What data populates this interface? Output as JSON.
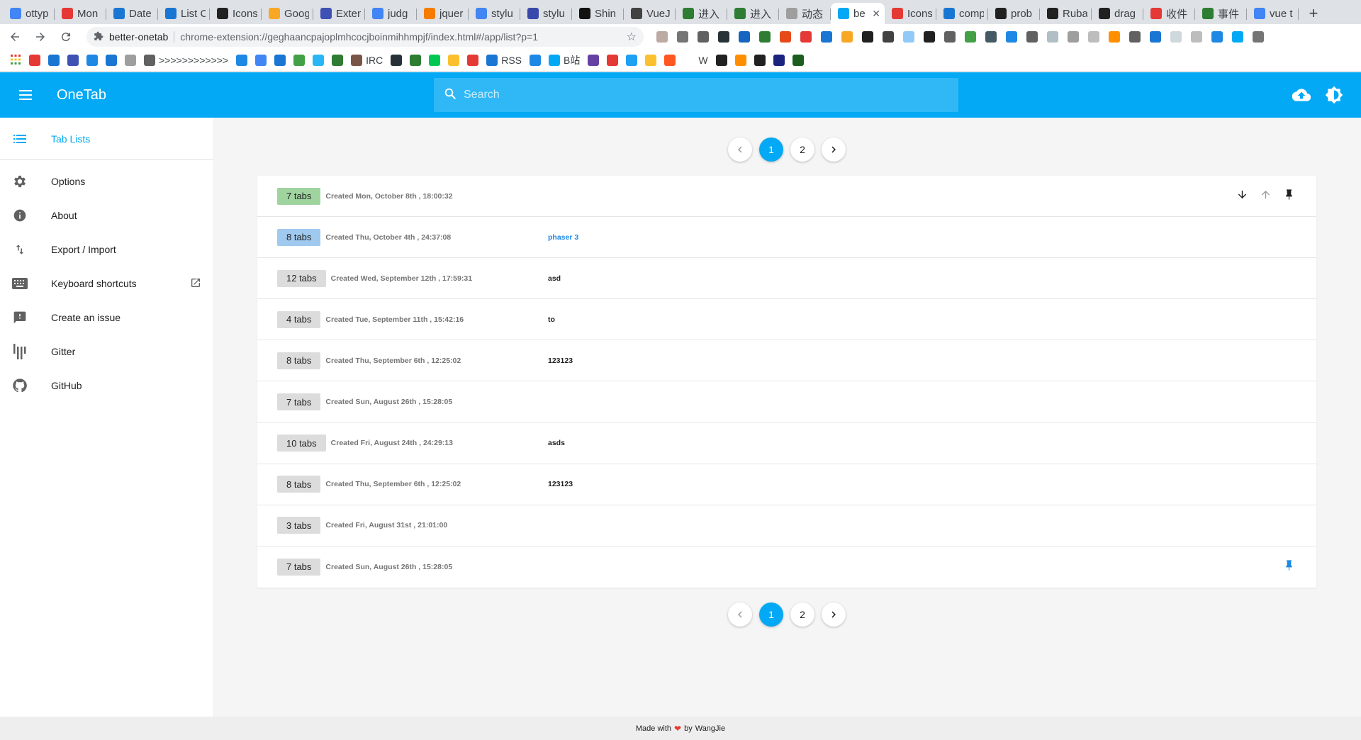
{
  "browser": {
    "tabs": [
      {
        "title": "ottyp",
        "color": "#4285f4"
      },
      {
        "title": "Mon",
        "color": "#e53935"
      },
      {
        "title": "Date",
        "color": "#1976d2"
      },
      {
        "title": "List C",
        "color": "#1976d2"
      },
      {
        "title": "Icons",
        "color": "#212121"
      },
      {
        "title": "Goog",
        "color": "#f9a825"
      },
      {
        "title": "Exten",
        "color": "#3f51b5"
      },
      {
        "title": "judg",
        "color": "#4285f4"
      },
      {
        "title": "jquer",
        "color": "#f57c00"
      },
      {
        "title": "stylu",
        "color": "#4285f4"
      },
      {
        "title": "stylu",
        "color": "#3949ab"
      },
      {
        "title": "Shin",
        "color": "#111111"
      },
      {
        "title": "VueJ",
        "color": "#424242"
      },
      {
        "title": "进入",
        "color": "#2e7d32"
      },
      {
        "title": "进入",
        "color": "#2e7d32"
      },
      {
        "title": "动态",
        "color": "#9e9e9e"
      },
      {
        "title": "be",
        "color": "#03a9f4",
        "active": true
      },
      {
        "title": "Icons",
        "color": "#e53935"
      },
      {
        "title": "comp",
        "color": "#1976d2"
      },
      {
        "title": "prob",
        "color": "#212121"
      },
      {
        "title": "Ruba",
        "color": "#212121"
      },
      {
        "title": "drag",
        "color": "#212121"
      },
      {
        "title": "收件",
        "color": "#e53935"
      },
      {
        "title": "事件",
        "color": "#2e7d32"
      },
      {
        "title": "vue t",
        "color": "#4285f4"
      }
    ],
    "address_host": "better-onetab",
    "address_url": "chrome-extension://geghaancpajoplmhcocjboinmihhmpjf/index.html#/app/list?p=1",
    "extension_colors": [
      "#bcaaa4",
      "#757575",
      "#616161",
      "#263238",
      "#1565c0",
      "#2e7d32",
      "#e64a19",
      "#e53935",
      "#1976d2",
      "#f9a825",
      "#212121",
      "#424242",
      "#90caf9",
      "#212121",
      "#616161",
      "#43a047",
      "#455a64",
      "#1e88e5",
      "#616161",
      "#b0bec5",
      "#9e9e9e",
      "#bdbdbd",
      "#ff8f00",
      "#616161",
      "#1976d2",
      "#cfd8dc",
      "#bdbdbd",
      "#1e88e5",
      "#03a9f4",
      "#757575"
    ],
    "bookmarks": [
      {
        "label": "",
        "color": "#e53935"
      },
      {
        "label": "",
        "color": "#1976d2"
      },
      {
        "label": "",
        "color": "#3f51b5"
      },
      {
        "label": "",
        "color": "#1e88e5"
      },
      {
        "label": "",
        "color": "#1976d2"
      },
      {
        "label": "",
        "color": "#9e9e9e"
      },
      {
        "label": ">>>>>>>>>>>>",
        "color": "#616161"
      },
      {
        "label": "",
        "color": "#1e88e5"
      },
      {
        "label": "",
        "color": "#4285f4"
      },
      {
        "label": "",
        "color": "#1976d2"
      },
      {
        "label": "",
        "color": "#43a047"
      },
      {
        "label": "",
        "color": "#29b6f6"
      },
      {
        "label": "",
        "color": "#2e7d32"
      },
      {
        "label": "IRC",
        "color": "#795548"
      },
      {
        "label": "",
        "color": "#263238"
      },
      {
        "label": "",
        "color": "#2e7d32"
      },
      {
        "label": "",
        "color": "#00c853"
      },
      {
        "label": "",
        "color": "#fbc02d"
      },
      {
        "label": "",
        "color": "#e53935"
      },
      {
        "label": "RSS",
        "color": "#1976d2"
      },
      {
        "label": "",
        "color": "#1e88e5"
      },
      {
        "label": "B站",
        "color": "#03a9f4"
      },
      {
        "label": "",
        "color": "#6441a5"
      },
      {
        "label": "",
        "color": "#e53935"
      },
      {
        "label": "",
        "color": "#1da1f2"
      },
      {
        "label": "",
        "color": "#fbc02d"
      },
      {
        "label": "",
        "color": "#ff5722"
      },
      {
        "label": "W",
        "color": "#ffffff"
      },
      {
        "label": "",
        "color": "#212121"
      },
      {
        "label": "",
        "color": "#ff8f00"
      },
      {
        "label": "",
        "color": "#212121"
      },
      {
        "label": "",
        "color": "#1a237e"
      },
      {
        "label": "",
        "color": "#1b5e20"
      }
    ]
  },
  "app": {
    "title": "OneTab",
    "search_placeholder": "Search",
    "accent": "#03a9f4"
  },
  "sidebar": {
    "items": [
      {
        "label": "Tab Lists",
        "icon": "list-icon",
        "active": true
      },
      {
        "label": "Options",
        "icon": "gear-icon"
      },
      {
        "label": "About",
        "icon": "info-icon"
      },
      {
        "label": "Export / Import",
        "icon": "import-export-icon"
      },
      {
        "label": "Keyboard shortcuts",
        "icon": "keyboard-icon",
        "external": true
      },
      {
        "label": "Create an issue",
        "icon": "feedback-icon"
      },
      {
        "label": "Gitter",
        "icon": "gitter-icon"
      },
      {
        "label": "GitHub",
        "icon": "github-icon"
      }
    ]
  },
  "pagination": {
    "pages": [
      "1",
      "2"
    ],
    "current": "1"
  },
  "tab_lists": [
    {
      "count": "7 tabs",
      "created": "Created Mon, October 8th , 18:00:32",
      "title": "",
      "chip": "green",
      "actions": [
        "move-down",
        "move-up",
        "pin"
      ]
    },
    {
      "count": "8 tabs",
      "created": "Created Thu, October 4th , 24:37:08",
      "title": "phaser 3",
      "chip": "blue",
      "title_link": true
    },
    {
      "count": "12 tabs",
      "created": "Created Wed, September 12th , 17:59:31",
      "title": "asd",
      "chip": "grey"
    },
    {
      "count": "4 tabs",
      "created": "Created Tue, September 11th , 15:42:16",
      "title": "to",
      "chip": "grey"
    },
    {
      "count": "8 tabs",
      "created": "Created Thu, September 6th , 12:25:02",
      "title": "123123",
      "chip": "grey"
    },
    {
      "count": "7 tabs",
      "created": "Created Sun, August 26th , 15:28:05",
      "title": "",
      "chip": "grey"
    },
    {
      "count": "10 tabs",
      "created": "Created Fri, August 24th , 24:29:13",
      "title": "asds",
      "chip": "grey"
    },
    {
      "count": "8 tabs",
      "created": "Created Thu, September 6th , 12:25:02",
      "title": "123123",
      "chip": "grey"
    },
    {
      "count": "3 tabs",
      "created": "Created Fri, August 31st , 21:01:00",
      "title": "",
      "chip": "grey"
    },
    {
      "count": "7 tabs",
      "created": "Created Sun, August 26th , 15:28:05",
      "title": "",
      "chip": "grey",
      "pinned": true
    }
  ],
  "footer": {
    "made_with": "Made with",
    "by": "by",
    "author": "WangJie"
  }
}
